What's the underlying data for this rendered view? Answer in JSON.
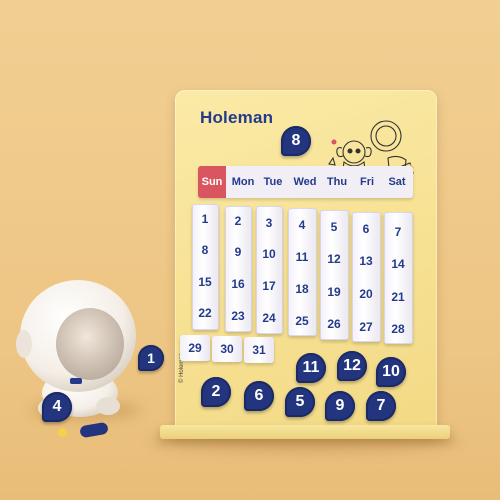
{
  "brand": "Holeman",
  "copyright": "© Holeman",
  "weekdays": [
    "Sun",
    "Mon",
    "Tue",
    "Wed",
    "Thu",
    "Fri",
    "Sat"
  ],
  "columns": [
    [
      "1",
      "8",
      "15",
      "22"
    ],
    [
      "2",
      "9",
      "16",
      "23"
    ],
    [
      "3",
      "10",
      "17",
      "24"
    ],
    [
      "4",
      "11",
      "18",
      "25"
    ],
    [
      "5",
      "12",
      "19",
      "26"
    ],
    [
      "6",
      "13",
      "20",
      "27"
    ],
    [
      "7",
      "14",
      "21",
      "28"
    ]
  ],
  "extra_days": [
    "29",
    "30",
    "31"
  ],
  "month_magnet": "8",
  "loose_magnets": [
    "1",
    "2",
    "6",
    "5",
    "9",
    "7",
    "11",
    "12",
    "10"
  ],
  "figure_magnet": "4",
  "colors": {
    "navy": "#23357e",
    "sunday": "#d95560",
    "board": "#f6e091",
    "background": "#efc98a"
  }
}
